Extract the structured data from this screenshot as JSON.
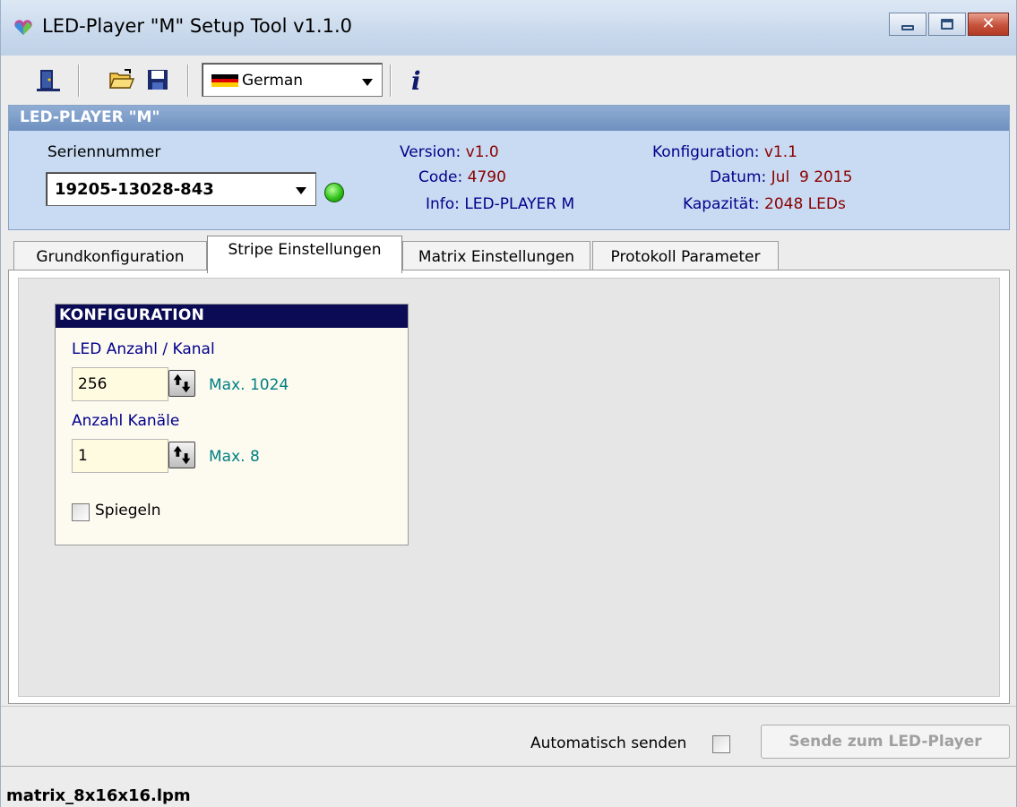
{
  "window": {
    "title": "LED-Player \"M\" Setup Tool v1.1.0",
    "app_icon": "heart-app-icon",
    "controls": [
      "minimize-icon",
      "maximize-icon",
      "close-icon"
    ]
  },
  "toolbar": {
    "icons": [
      "exit-door-icon",
      "open-folder-icon",
      "save-disk-icon",
      "info-icon"
    ],
    "language": {
      "selected": "German",
      "flag_colors": [
        "#000000",
        "#dd0000",
        "#ffce00"
      ]
    },
    "info_glyph": "i"
  },
  "device": {
    "header": "LED-PLAYER \"M\"",
    "serial_label": "Seriennummer",
    "serial_value": "19205-13028-843",
    "status_color": "#31c31a",
    "version_label": "Version:",
    "version_value": "v1.0",
    "code_label": "Code:",
    "code_value": "4790",
    "info_label": "Info:",
    "info_value": "LED-PLAYER M",
    "config_label": "Konfiguration:",
    "config_value": "v1.1",
    "date_label": "Datum:",
    "date_value": "Jul  9 2015",
    "capacity_label": "Kapazität:",
    "capacity_value": "2048 LEDs"
  },
  "tabs": [
    {
      "label": "Grundkonfiguration",
      "active": false
    },
    {
      "label": "Stripe Einstellungen",
      "active": true
    },
    {
      "label": "Matrix Einstellungen",
      "active": false
    },
    {
      "label": "Protokoll Parameter",
      "active": false
    }
  ],
  "konfiguration": {
    "title": "KONFIGURATION",
    "led_count_label": "LED Anzahl / Kanal",
    "led_count_value": "256",
    "led_count_max": "Max. 1024",
    "channels_label": "Anzahl Kanäle",
    "channels_value": "1",
    "channels_max": "Max. 8",
    "mirror_label": "Spiegeln",
    "mirror_checked": false
  },
  "footer": {
    "auto_send_label": "Automatisch senden",
    "auto_send_checked": false,
    "send_button": "Sende zum LED-Player",
    "status_file": "matrix_8x16x16.lpm"
  }
}
